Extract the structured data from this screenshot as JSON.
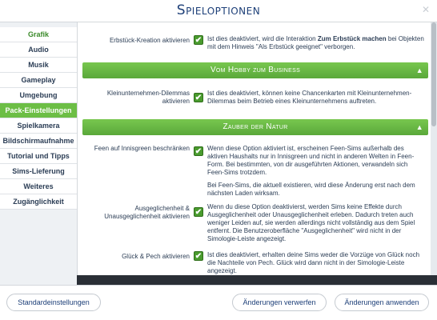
{
  "window": {
    "title": "Spieloptionen"
  },
  "sidebar": {
    "items": [
      {
        "label": "Grafik"
      },
      {
        "label": "Audio"
      },
      {
        "label": "Musik"
      },
      {
        "label": "Gameplay"
      },
      {
        "label": "Umgebung"
      },
      {
        "label": "Pack-Einstellungen"
      },
      {
        "label": "Spielkamera"
      },
      {
        "label": "Bildschirmaufnahme"
      },
      {
        "label": "Tutorial und Tipps"
      },
      {
        "label": "Sims-Lieferung"
      },
      {
        "label": "Weiteres"
      },
      {
        "label": "Zugänglichkeit"
      }
    ]
  },
  "main": {
    "heirloom": {
      "label": "Erbstück-Kreation aktivieren",
      "desc_before": "Ist dies deaktiviert, wird die Interaktion ",
      "desc_bold": "Zum Erbstück machen",
      "desc_after": " bei Objekten mit dem Hinweis \"Als Erbstück geeignet\" verborgen."
    },
    "section_hobby": {
      "title": "Vom Hobby zum Business"
    },
    "dilemmas": {
      "label": "Kleinunternehmen-Dilemmas aktivieren",
      "desc": "Ist dies deaktiviert, können keine Chancenkarten mit Kleinunternehmen-Dilemmas beim Betrieb eines Kleinunternehmens auftreten."
    },
    "section_nature": {
      "title": "Zauber der Natur"
    },
    "fairies": {
      "label": "Feen auf Innisgreen beschränken",
      "desc": "Wenn diese Option aktiviert ist, erscheinen Feen-Sims außerhalb des aktiven Haushalts nur in Innisgreen und nicht in anderen Welten in Feen-Form. Bei bestimmten, von dir ausgeführten Aktionen, verwandeln sich Feen-Sims trotzdem.",
      "desc2": "Bei Feen-Sims, die aktuell existieren, wird diese Änderung erst nach dem nächsten Laden wirksam."
    },
    "balance": {
      "label": "Ausgeglichenheit & Unausgeglichenheit aktivieren",
      "desc": "Wenn du diese Option deaktivierst, werden Sims keine Effekte durch Ausgeglichenheit oder Unausgeglichenheit erleben. Dadurch treten auch weniger Leiden auf, sie werden allerdings nicht vollständig aus dem Spiel entfernt. Die Benutzeroberfläche \"Ausgeglichenheit\" wird nicht in der Simologie-Leiste angezeigt."
    },
    "luck": {
      "label": "Glück & Pech aktivieren",
      "desc": "Ist dies deaktiviert, erhalten deine Sims weder die Vorzüge von Glück noch die Nachteile von Pech. Glück wird dann nicht in der Simologie-Leiste angezeigt."
    }
  },
  "footer": {
    "defaults_label": "Standardeinstellungen",
    "discard_label": "Änderungen verwerfen",
    "apply_label": "Änderungen anwenden"
  },
  "colors": {
    "accent": "#6cbe45",
    "text": "#2b3d55",
    "title": "#1d3f78"
  }
}
